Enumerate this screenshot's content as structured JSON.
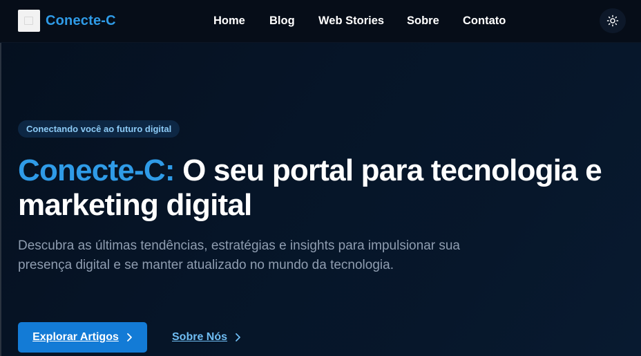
{
  "header": {
    "brand": "Conecte-C",
    "nav": [
      {
        "label": "Home"
      },
      {
        "label": "Blog"
      },
      {
        "label": "Web Stories"
      },
      {
        "label": "Sobre"
      },
      {
        "label": "Contato"
      }
    ],
    "theme_toggle_icon": "sun-icon"
  },
  "hero": {
    "badge": "Conectando você ao futuro digital",
    "headline_accent": "Conecte-C:",
    "headline_rest": "O seu portal para tecnologia e marketing digital",
    "subtitle": "Descubra as últimas tendências, estratégias e insights para impulsionar sua presença digital e se manter atualizado no mundo da tecnologia.",
    "primary_button": "Explorar Artigos",
    "secondary_button": "Sobre Nós"
  },
  "colors": {
    "accent": "#2f9be7",
    "primary_button": "#137bd6",
    "background": "#05101f"
  }
}
